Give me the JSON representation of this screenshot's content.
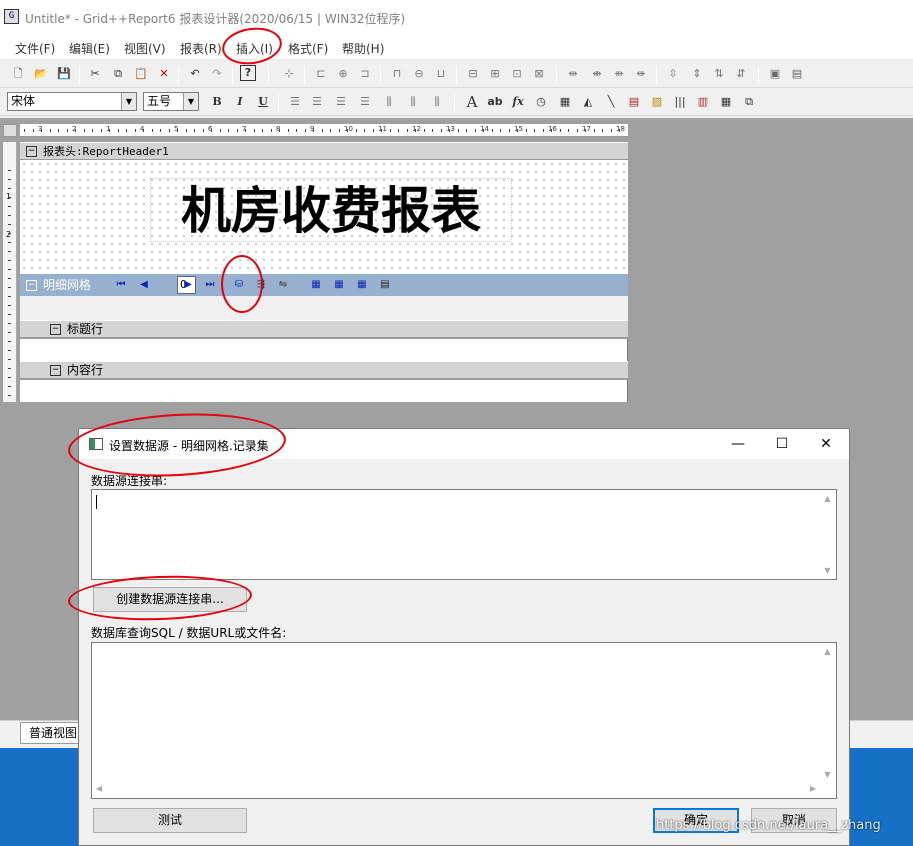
{
  "window": {
    "title": "Untitle* - Grid++Report6 报表设计器(2020/06/15 | WIN32位程序)"
  },
  "menu": [
    "文件(F)",
    "编辑(E)",
    "视图(V)",
    "报表(R)",
    "插入(I)",
    "格式(F)",
    "帮助(H)"
  ],
  "format_bar": {
    "font_name": "宋体",
    "font_size": "五号",
    "bold": "B",
    "italic": "I",
    "underline": "U"
  },
  "ruler": {
    "ticks": [
      "3",
      "2",
      "1",
      "4",
      "5",
      "6",
      "7",
      "8",
      "9",
      "10",
      "11",
      "12",
      "13",
      "14",
      "15",
      "16",
      "17",
      "18"
    ]
  },
  "vruler": {
    "marks": [
      "1",
      "2"
    ]
  },
  "designer": {
    "report_header_band": "报表头:ReportHeader1",
    "report_title": "机房收费报表",
    "detail_grid_band": "明细网格",
    "grid_page_value": "0",
    "column_title_row": "标题行",
    "content_row": "内容行",
    "normal_view_tab": "普通视图"
  },
  "icons": {
    "new": "new-file-icon",
    "open": "open-folder-icon",
    "save": "save-icon",
    "cut": "cut-icon",
    "copy": "copy-icon",
    "paste": "paste-icon",
    "delete": "delete-icon",
    "undo": "undo-icon",
    "redo": "redo-icon",
    "help": "help-icon"
  },
  "dialog": {
    "title": "设置数据源 - 明细网格.记录集",
    "connection_label": "数据源连接串:",
    "connection_value": "",
    "create_connection_button": "创建数据源连接串...",
    "query_label": "数据库查询SQL / 数据URL或文件名:",
    "query_value": "",
    "test_button": "测试",
    "ok_button": "确定",
    "cancel_button": "取消"
  },
  "watermark": "https://blog.csdn.net/laura__zhang",
  "colors": {
    "grid_band": "#97b0d0",
    "annotation": "#e3000b",
    "desktop": "#1570c6",
    "focus": "#0078d7"
  }
}
